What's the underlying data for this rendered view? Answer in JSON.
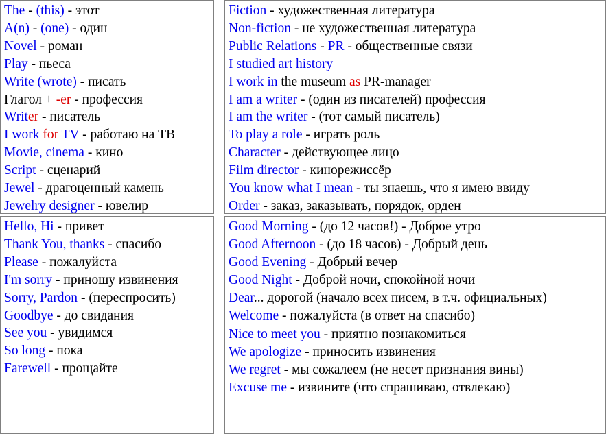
{
  "document": {
    "title": "English-Russian vocabulary reference sheet",
    "colors": {
      "english_term": "#0000ee",
      "emphasis": "#dd0000",
      "translation": "#000000",
      "panel_border": "#808080",
      "background": "#ffffff"
    }
  },
  "panels": {
    "top_left": {
      "name": "professions-and-writing-vocabulary",
      "lines": [
        {
          "id": "the",
          "parts": [
            {
              "text": "The",
              "color": "en"
            },
            {
              "text": " - ",
              "color": "sep"
            },
            {
              "text": "(this)",
              "color": "en"
            },
            {
              "text": " - ",
              "color": "sep"
            },
            {
              "text": "этот",
              "color": "ru"
            }
          ]
        },
        {
          "id": "an",
          "parts": [
            {
              "text": "A(n)",
              "color": "en"
            },
            {
              "text": " - ",
              "color": "sep"
            },
            {
              "text": "(one)",
              "color": "en"
            },
            {
              "text": " - ",
              "color": "sep"
            },
            {
              "text": "один",
              "color": "ru"
            }
          ]
        },
        {
          "id": "novel",
          "parts": [
            {
              "text": "Novel",
              "color": "en"
            },
            {
              "text": " - ",
              "color": "sep"
            },
            {
              "text": "роман",
              "color": "ru"
            }
          ]
        },
        {
          "id": "play",
          "parts": [
            {
              "text": "Play",
              "color": "en"
            },
            {
              "text": " - ",
              "color": "sep"
            },
            {
              "text": "пьеса",
              "color": "ru"
            }
          ]
        },
        {
          "id": "write",
          "parts": [
            {
              "text": "Write",
              "color": "en"
            },
            {
              "text": " ",
              "color": "sep"
            },
            {
              "text": "(wrote)",
              "color": "en"
            },
            {
              "text": " - ",
              "color": "sep"
            },
            {
              "text": "писать",
              "color": "ru"
            }
          ]
        },
        {
          "id": "verb-plus-er",
          "parts": [
            {
              "text": "Глагол + ",
              "color": "ru"
            },
            {
              "text": "-er",
              "color": "hl"
            },
            {
              "text": " - ",
              "color": "sep"
            },
            {
              "text": "профессия",
              "color": "ru"
            }
          ]
        },
        {
          "id": "writer",
          "parts": [
            {
              "text": "Writ",
              "color": "en"
            },
            {
              "text": "er",
              "color": "hl"
            },
            {
              "text": " - ",
              "color": "sep"
            },
            {
              "text": "писатель",
              "color": "ru"
            }
          ]
        },
        {
          "id": "i-work-for-tv",
          "parts": [
            {
              "text": "I work ",
              "color": "en"
            },
            {
              "text": "for",
              "color": "hl"
            },
            {
              "text": " TV",
              "color": "en"
            },
            {
              "text": " - ",
              "color": "sep"
            },
            {
              "text": "работаю на ТВ",
              "color": "ru"
            }
          ]
        },
        {
          "id": "movie-cinema",
          "parts": [
            {
              "text": "Movie, cinema",
              "color": "en"
            },
            {
              "text": " - ",
              "color": "sep"
            },
            {
              "text": "кино",
              "color": "ru"
            }
          ]
        },
        {
          "id": "script",
          "parts": [
            {
              "text": "Script",
              "color": "en"
            },
            {
              "text": " - ",
              "color": "sep"
            },
            {
              "text": "сценарий",
              "color": "ru"
            }
          ]
        },
        {
          "id": "jewel",
          "parts": [
            {
              "text": "Jewel",
              "color": "en"
            },
            {
              "text": " - ",
              "color": "sep"
            },
            {
              "text": "драгоценный камень",
              "color": "ru"
            }
          ]
        },
        {
          "id": "jewelry-designer",
          "parts": [
            {
              "text": "Jewelry designer",
              "color": "en"
            },
            {
              "text": " - ",
              "color": "sep"
            },
            {
              "text": "ювелир",
              "color": "ru"
            }
          ]
        }
      ]
    },
    "top_right": {
      "name": "media-and-arts-vocabulary",
      "lines": [
        {
          "id": "fiction",
          "parts": [
            {
              "text": "Fiction",
              "color": "en"
            },
            {
              "text": " - ",
              "color": "sep"
            },
            {
              "text": "художественная литература",
              "color": "ru"
            }
          ]
        },
        {
          "id": "non-fiction",
          "parts": [
            {
              "text": "Non-fiction",
              "color": "en"
            },
            {
              "text": " - ",
              "color": "sep"
            },
            {
              "text": "не художественная литература",
              "color": "ru"
            }
          ]
        },
        {
          "id": "public-relations",
          "parts": [
            {
              "text": "Public Relations",
              "color": "en"
            },
            {
              "text": " - ",
              "color": "sep"
            },
            {
              "text": "PR",
              "color": "en"
            },
            {
              "text": " - ",
              "color": "sep"
            },
            {
              "text": "общественные связи",
              "color": "ru"
            }
          ]
        },
        {
          "id": "i-studied-art-history",
          "parts": [
            {
              "text": "I studied art history",
              "color": "en"
            }
          ]
        },
        {
          "id": "i-work-in-the-museum",
          "parts": [
            {
              "text": "I work in",
              "color": "en"
            },
            {
              "text": " the museum ",
              "color": "ru"
            },
            {
              "text": "as",
              "color": "hl"
            },
            {
              "text": " PR-manager",
              "color": "ru"
            }
          ]
        },
        {
          "id": "i-am-a-writer",
          "parts": [
            {
              "text": "I am a writer",
              "color": "en"
            },
            {
              "text": " - ",
              "color": "sep"
            },
            {
              "text": "(один из писателей) профессия",
              "color": "ru"
            }
          ]
        },
        {
          "id": "i-am-the-writer",
          "parts": [
            {
              "text": "I am the writer",
              "color": "en"
            },
            {
              "text": " - ",
              "color": "sep"
            },
            {
              "text": "(тот самый писатель)",
              "color": "ru"
            }
          ]
        },
        {
          "id": "to-play-a-role",
          "parts": [
            {
              "text": "To play a role",
              "color": "en"
            },
            {
              "text": " - ",
              "color": "sep"
            },
            {
              "text": "играть роль",
              "color": "ru"
            }
          ]
        },
        {
          "id": "character",
          "parts": [
            {
              "text": "Character",
              "color": "en"
            },
            {
              "text": " - ",
              "color": "sep"
            },
            {
              "text": "действующее лицо",
              "color": "ru"
            }
          ]
        },
        {
          "id": "film-director",
          "parts": [
            {
              "text": "Film director",
              "color": "en"
            },
            {
              "text": " - ",
              "color": "sep"
            },
            {
              "text": "кинорежиссёр",
              "color": "ru"
            }
          ]
        },
        {
          "id": "you-know-what-i-mean",
          "parts": [
            {
              "text": "You know what I mean",
              "color": "en"
            },
            {
              "text": " - ",
              "color": "sep"
            },
            {
              "text": "ты знаешь, что я имею ввиду",
              "color": "ru"
            }
          ]
        },
        {
          "id": "order",
          "parts": [
            {
              "text": "Order",
              "color": "en"
            },
            {
              "text": " - ",
              "color": "sep"
            },
            {
              "text": "заказ, заказывать, порядок, орден",
              "color": "ru"
            }
          ]
        }
      ]
    },
    "bottom_left": {
      "name": "greetings-and-farewells-vocabulary",
      "lines": [
        {
          "id": "hello-hi",
          "parts": [
            {
              "text": "Hello, Hi",
              "color": "en"
            },
            {
              "text": " - ",
              "color": "sep"
            },
            {
              "text": "привет",
              "color": "ru"
            }
          ]
        },
        {
          "id": "thank-you",
          "parts": [
            {
              "text": "Thank You, thanks",
              "color": "en"
            },
            {
              "text": " - ",
              "color": "sep"
            },
            {
              "text": "спасибо",
              "color": "ru"
            }
          ]
        },
        {
          "id": "please",
          "parts": [
            {
              "text": "Please",
              "color": "en"
            },
            {
              "text": " - ",
              "color": "sep"
            },
            {
              "text": "пожалуйста",
              "color": "ru"
            }
          ]
        },
        {
          "id": "im-sorry",
          "parts": [
            {
              "text": "I'm sorry",
              "color": "en"
            },
            {
              "text": " - ",
              "color": "sep"
            },
            {
              "text": "приношу извинения",
              "color": "ru"
            }
          ]
        },
        {
          "id": "sorry-pardon",
          "parts": [
            {
              "text": "Sorry, Pardon",
              "color": "en"
            },
            {
              "text": " - ",
              "color": "sep"
            },
            {
              "text": "(переспросить)",
              "color": "ru"
            }
          ]
        },
        {
          "id": "goodbye",
          "parts": [
            {
              "text": "Goodbye",
              "color": "en"
            },
            {
              "text": " - ",
              "color": "sep"
            },
            {
              "text": "до свидания",
              "color": "ru"
            }
          ]
        },
        {
          "id": "see-you",
          "parts": [
            {
              "text": "See you",
              "color": "en"
            },
            {
              "text": " - ",
              "color": "sep"
            },
            {
              "text": "увидимся",
              "color": "ru"
            }
          ]
        },
        {
          "id": "so-long",
          "parts": [
            {
              "text": "So long",
              "color": "en"
            },
            {
              "text": " - ",
              "color": "sep"
            },
            {
              "text": "пока",
              "color": "ru"
            }
          ]
        },
        {
          "id": "farewell",
          "parts": [
            {
              "text": "Farewell",
              "color": "en"
            },
            {
              "text": " - ",
              "color": "sep"
            },
            {
              "text": "прощайте",
              "color": "ru"
            }
          ]
        }
      ]
    },
    "bottom_right": {
      "name": "polite-phrases-vocabulary",
      "lines": [
        {
          "id": "good-morning",
          "parts": [
            {
              "text": "Good Morning",
              "color": "en"
            },
            {
              "text": " - ",
              "color": "sep"
            },
            {
              "text": "(до 12 часов!) - Доброе утро",
              "color": "ru"
            }
          ]
        },
        {
          "id": "good-afternoon",
          "parts": [
            {
              "text": "Good Afternoon",
              "color": "en"
            },
            {
              "text": " - ",
              "color": "sep"
            },
            {
              "text": "(до 18 часов) - Добрый день",
              "color": "ru"
            }
          ]
        },
        {
          "id": "good-evening",
          "parts": [
            {
              "text": "Good Evening",
              "color": "en"
            },
            {
              "text": " - ",
              "color": "sep"
            },
            {
              "text": "Добрый вечер",
              "color": "ru"
            }
          ]
        },
        {
          "id": "good-night",
          "parts": [
            {
              "text": "Good Night",
              "color": "en"
            },
            {
              "text": " - ",
              "color": "sep"
            },
            {
              "text": "Доброй ночи, спокойной ночи",
              "color": "ru"
            }
          ]
        },
        {
          "id": "dear",
          "parts": [
            {
              "text": "Dear",
              "color": "en"
            },
            {
              "text": "... дорогой (начало всех писем, в т.ч. официальных)",
              "color": "ru"
            }
          ]
        },
        {
          "id": "welcome",
          "parts": [
            {
              "text": "Welcome",
              "color": "en"
            },
            {
              "text": " - ",
              "color": "sep"
            },
            {
              "text": "пожалуйста (в ответ на спасибо)",
              "color": "ru"
            }
          ]
        },
        {
          "id": "nice-to-meet-you",
          "parts": [
            {
              "text": "Nice to meet you",
              "color": "en"
            },
            {
              "text": " - ",
              "color": "sep"
            },
            {
              "text": "приятно познакомиться",
              "color": "ru"
            }
          ]
        },
        {
          "id": "we-apologize",
          "parts": [
            {
              "text": "We apologize",
              "color": "en"
            },
            {
              "text": " - ",
              "color": "sep"
            },
            {
              "text": "приносить извинения",
              "color": "ru"
            }
          ]
        },
        {
          "id": "we-regret",
          "parts": [
            {
              "text": "We regret",
              "color": "en"
            },
            {
              "text": " - ",
              "color": "sep"
            },
            {
              "text": "мы сожалеем (не несет признания вины)",
              "color": "ru"
            }
          ]
        },
        {
          "id": "excuse-me",
          "parts": [
            {
              "text": "Excuse me",
              "color": "en"
            },
            {
              "text": " - ",
              "color": "sep"
            },
            {
              "text": "извините (что спрашиваю, отвлекаю)",
              "color": "ru"
            }
          ]
        }
      ]
    }
  }
}
